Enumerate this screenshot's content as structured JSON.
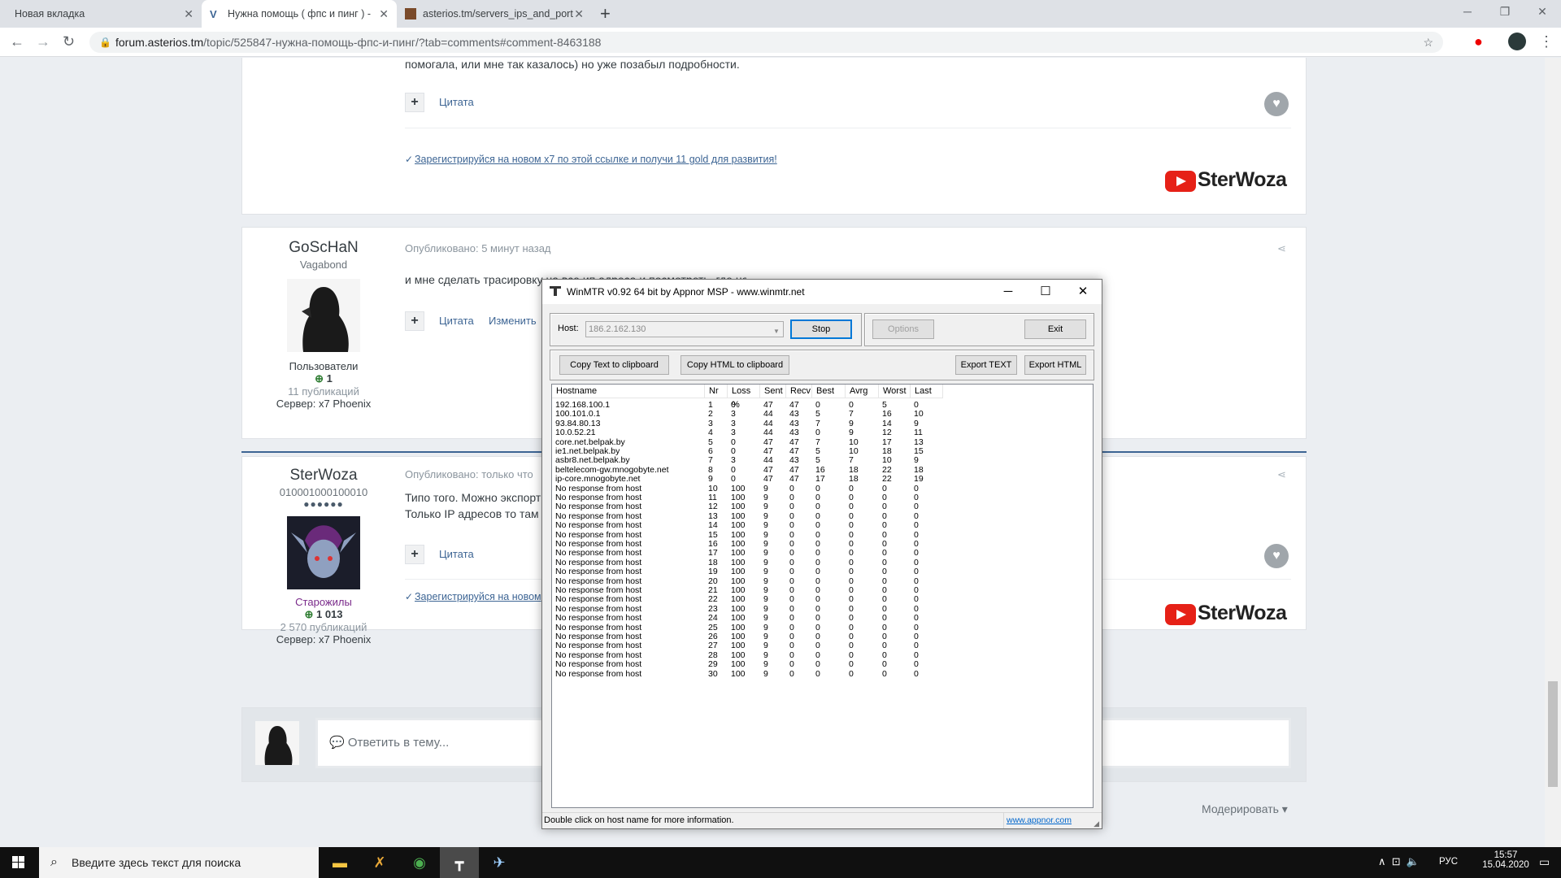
{
  "browser": {
    "tabs": [
      {
        "title": "Новая вкладка"
      },
      {
        "title": "Нужна помощь ( фпс и пинг ) -"
      },
      {
        "title": "asterios.tm/servers_ips_and_port"
      }
    ],
    "url_host": "forum.asterios.tm",
    "url_path": "/topic/525847-нужна-помощь-фпс-и-пинг/?tab=comments#comment-8463188"
  },
  "forum": {
    "post1": {
      "text_tail": "помогала, или мне так казалось) но уже позабыл подробности.",
      "quote_label": "Цитата",
      "promo": "Зарегистрируйся на новом x7 по этой ссылке и получи 11 gold для развития!",
      "promo_check": "✓",
      "logo": "SterWoza"
    },
    "post2": {
      "author": "GoScHaN",
      "rank": "Vagabond",
      "group": "Пользователи",
      "reputation": "1",
      "posts": "11 публикаций",
      "server": "Сервер: x7 Phoenix",
      "meta": "Опубликовано: 5 минут назад",
      "text": "и мне сделать трасировку на все ип адреса и посмотреть, где не хуже",
      "quote_label": "Цитата",
      "edit_label": "Изменить"
    },
    "post3": {
      "author": "SterWoza",
      "rank": "010001000100010",
      "group": "Старожилы",
      "reputation": "1 013",
      "posts": "2 570 публикаций",
      "server": "Сервер: x7 Phoenix",
      "meta": "Опубликовано: только что",
      "text_line1": "Типо того. Можно экспорт",
      "text_line2": "Только IP адресов то там",
      "quote_label": "Цитата",
      "promo": "Зарегистрируйся на новом",
      "promo_check": "✓",
      "logo": "SterWoza"
    },
    "reply_placeholder": "💬 Ответить в тему...",
    "moderate_label": "Модерировать ▾"
  },
  "winmtr": {
    "title": "WinMTR v0.92 64 bit by Appnor MSP - www.winmtr.net",
    "host_label": "Host:",
    "host_value": "186.2.162.130",
    "stop": "Stop",
    "options": "Options",
    "exit": "Exit",
    "copy_text": "Copy Text to clipboard",
    "copy_html": "Copy HTML to clipboard",
    "export_text": "Export TEXT",
    "export_html": "Export HTML",
    "columns": [
      "Hostname",
      "Nr",
      "Loss %",
      "Sent",
      "Recv",
      "Best",
      "Avrg",
      "Worst",
      "Last"
    ],
    "rows": [
      [
        "192.168.100.1",
        "1",
        "0",
        "47",
        "47",
        "0",
        "0",
        "5",
        "0"
      ],
      [
        "100.101.0.1",
        "2",
        "3",
        "44",
        "43",
        "5",
        "7",
        "16",
        "10"
      ],
      [
        "93.84.80.13",
        "3",
        "3",
        "44",
        "43",
        "7",
        "9",
        "14",
        "9"
      ],
      [
        "10.0.52.21",
        "4",
        "3",
        "44",
        "43",
        "0",
        "9",
        "12",
        "11"
      ],
      [
        "core.net.belpak.by",
        "5",
        "0",
        "47",
        "47",
        "7",
        "10",
        "17",
        "13"
      ],
      [
        "ie1.net.belpak.by",
        "6",
        "0",
        "47",
        "47",
        "5",
        "10",
        "18",
        "15"
      ],
      [
        "asbr8.net.belpak.by",
        "7",
        "3",
        "44",
        "43",
        "5",
        "7",
        "10",
        "9"
      ],
      [
        "beltelecom-gw.mnogobyte.net",
        "8",
        "0",
        "47",
        "47",
        "16",
        "18",
        "22",
        "18"
      ],
      [
        "ip-core.mnogobyte.net",
        "9",
        "0",
        "47",
        "47",
        "17",
        "18",
        "22",
        "19"
      ],
      [
        "No response from host",
        "10",
        "100",
        "9",
        "0",
        "0",
        "0",
        "0",
        "0"
      ],
      [
        "No response from host",
        "11",
        "100",
        "9",
        "0",
        "0",
        "0",
        "0",
        "0"
      ],
      [
        "No response from host",
        "12",
        "100",
        "9",
        "0",
        "0",
        "0",
        "0",
        "0"
      ],
      [
        "No response from host",
        "13",
        "100",
        "9",
        "0",
        "0",
        "0",
        "0",
        "0"
      ],
      [
        "No response from host",
        "14",
        "100",
        "9",
        "0",
        "0",
        "0",
        "0",
        "0"
      ],
      [
        "No response from host",
        "15",
        "100",
        "9",
        "0",
        "0",
        "0",
        "0",
        "0"
      ],
      [
        "No response from host",
        "16",
        "100",
        "9",
        "0",
        "0",
        "0",
        "0",
        "0"
      ],
      [
        "No response from host",
        "17",
        "100",
        "9",
        "0",
        "0",
        "0",
        "0",
        "0"
      ],
      [
        "No response from host",
        "18",
        "100",
        "9",
        "0",
        "0",
        "0",
        "0",
        "0"
      ],
      [
        "No response from host",
        "19",
        "100",
        "9",
        "0",
        "0",
        "0",
        "0",
        "0"
      ],
      [
        "No response from host",
        "20",
        "100",
        "9",
        "0",
        "0",
        "0",
        "0",
        "0"
      ],
      [
        "No response from host",
        "21",
        "100",
        "9",
        "0",
        "0",
        "0",
        "0",
        "0"
      ],
      [
        "No response from host",
        "22",
        "100",
        "9",
        "0",
        "0",
        "0",
        "0",
        "0"
      ],
      [
        "No response from host",
        "23",
        "100",
        "9",
        "0",
        "0",
        "0",
        "0",
        "0"
      ],
      [
        "No response from host",
        "24",
        "100",
        "9",
        "0",
        "0",
        "0",
        "0",
        "0"
      ],
      [
        "No response from host",
        "25",
        "100",
        "9",
        "0",
        "0",
        "0",
        "0",
        "0"
      ],
      [
        "No response from host",
        "26",
        "100",
        "9",
        "0",
        "0",
        "0",
        "0",
        "0"
      ],
      [
        "No response from host",
        "27",
        "100",
        "9",
        "0",
        "0",
        "0",
        "0",
        "0"
      ],
      [
        "No response from host",
        "28",
        "100",
        "9",
        "0",
        "0",
        "0",
        "0",
        "0"
      ],
      [
        "No response from host",
        "29",
        "100",
        "9",
        "0",
        "0",
        "0",
        "0",
        "0"
      ],
      [
        "No response from host",
        "30",
        "100",
        "9",
        "0",
        "0",
        "0",
        "0",
        "0"
      ]
    ],
    "status": "Double click on host name for more information.",
    "status_link": "www.appnor.com"
  },
  "taskbar": {
    "search_placeholder": "Введите здесь текст для поиска",
    "lang": "РУС",
    "time": "15:57",
    "date": "15.04.2020"
  },
  "colors": {
    "accent": "#3d6594",
    "youtube": "#e62117"
  }
}
